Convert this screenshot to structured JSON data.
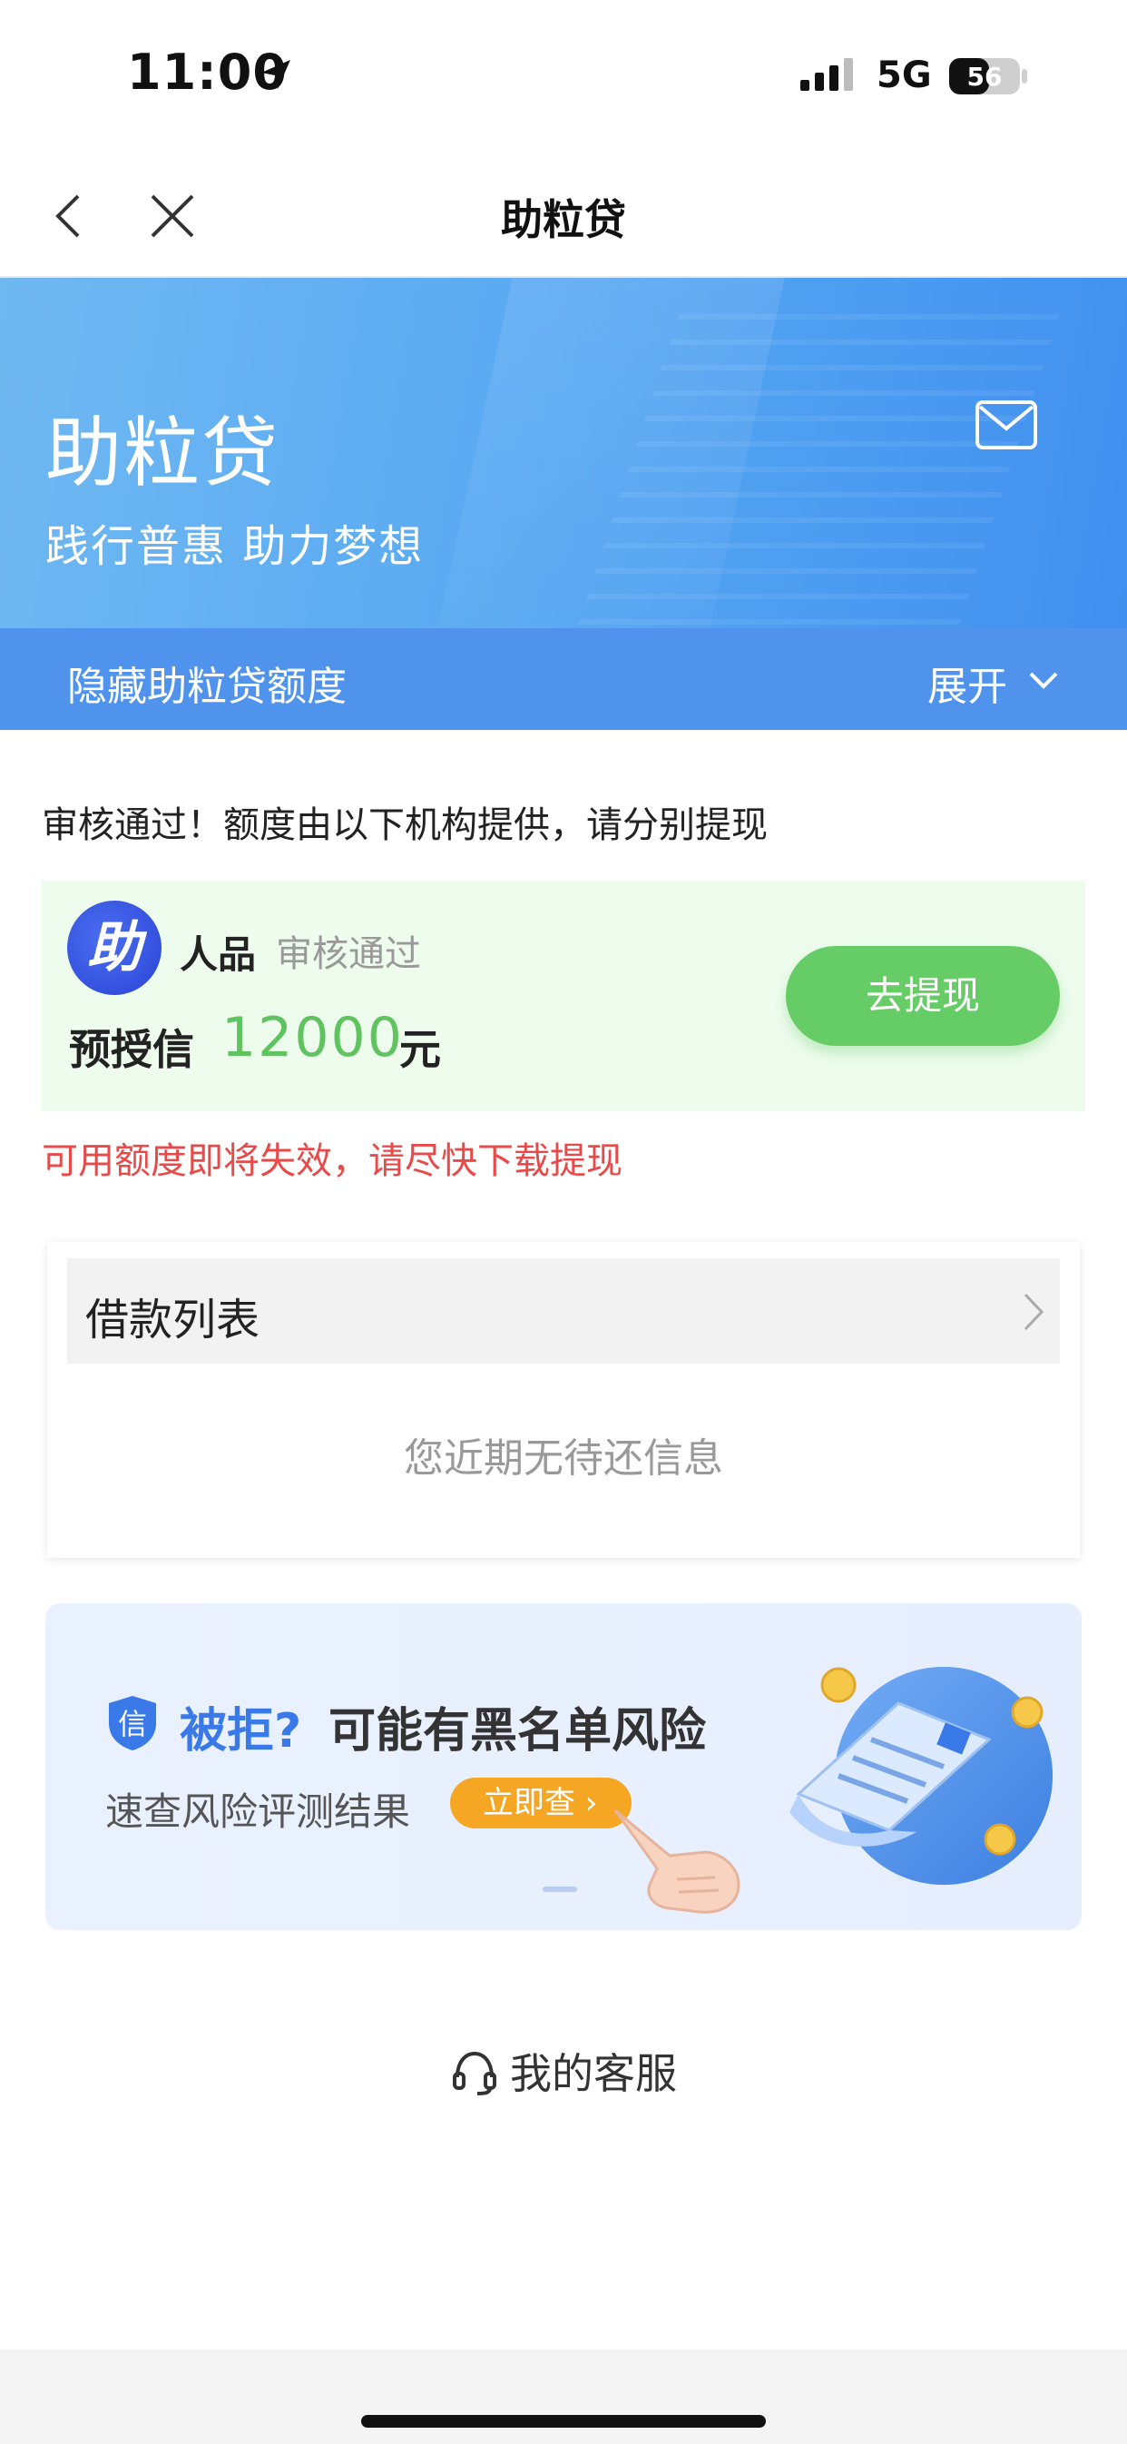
{
  "status_bar": {
    "time": "11:00",
    "network": "5G",
    "battery": "56"
  },
  "nav": {
    "title": "助粒贷"
  },
  "banner": {
    "title": "助粒贷",
    "subtitle": "践行普惠 助力梦想",
    "quota_toggle_label": "隐藏助粒贷额度",
    "expand_label": "展开"
  },
  "notice": "审核通过！额度由以下机构提供，请分别提现",
  "lender": {
    "logo_text": "助",
    "name": "人品",
    "status": "审核通过",
    "credit_label": "预授信",
    "credit_amount": "12000",
    "credit_unit": "元",
    "button_label": "去提现"
  },
  "warning": "可用额度即将失效，请尽快下载提现",
  "loans": {
    "title": "借款列表",
    "empty_text": "您近期无待还信息"
  },
  "ad": {
    "badge": "信",
    "rejected": "被拒?",
    "risk": "可能有黑名单风险",
    "subtitle": "速查风险评测结果",
    "button_label": "立即查"
  },
  "service": {
    "label": "我的客服"
  },
  "colors": {
    "accent_blue": "#4f93ec",
    "green": "#66cc66",
    "warning_red": "#e84a4a",
    "orange": "#f5a623"
  }
}
